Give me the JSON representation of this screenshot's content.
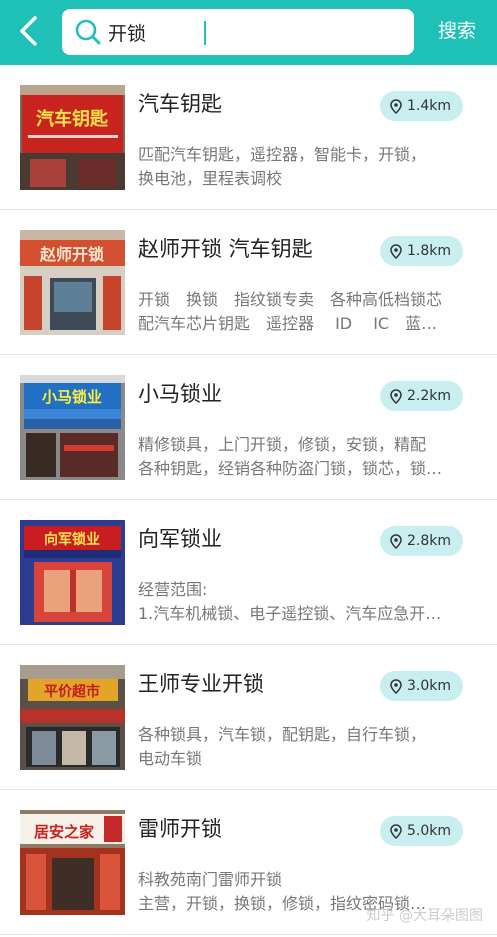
{
  "header": {
    "search_value": "开锁",
    "search_button": "搜索"
  },
  "results": [
    {
      "name": "汽车钥匙",
      "distance": "1.4km",
      "desc": [
        "匹配汽车钥匙，遥控器，智能卡，开锁，",
        "换电池，里程表调校"
      ],
      "sign": "汽车钥匙"
    },
    {
      "name": "赵师开锁 汽车钥匙",
      "distance": "1.8km",
      "desc": [
        "开锁　换锁　指纹锁专卖　各种高低档锁芯",
        "配汽车芯片钥匙　遥控器　 ID　 IC　蓝…"
      ],
      "sign": "赵师开锁"
    },
    {
      "name": "小马锁业",
      "distance": "2.2km",
      "desc": [
        "精修锁具，上门开锁，修锁，安锁，精配",
        "各种钥匙，经销各种防盗门锁，锁芯，锁…"
      ],
      "sign": "小马锁业"
    },
    {
      "name": "向军锁业",
      "distance": "2.8km",
      "desc": [
        "经营范围:",
        "1.汽车机械锁、电子遥控锁、汽车应急开…"
      ],
      "sign": "向军锁业"
    },
    {
      "name": "王师专业开锁",
      "distance": "3.0km",
      "desc": [
        "各种锁具，汽车锁，配钥匙，自行车锁，",
        "电动车锁"
      ],
      "sign": "平价超市"
    },
    {
      "name": "雷师开锁",
      "distance": "5.0km",
      "desc": [
        "科教苑南门雷师开锁",
        "主营，开锁，换锁，修锁，指纹密码锁…"
      ],
      "sign": "居安之家"
    }
  ],
  "watermark": "知乎 @大耳朵图图",
  "colors": {
    "accent": "#1fc1b7",
    "badge_bg": "#c8eef0"
  },
  "icons": {
    "back": "chevron-left-icon",
    "search": "search-icon",
    "distance": "location-pin-icon"
  }
}
